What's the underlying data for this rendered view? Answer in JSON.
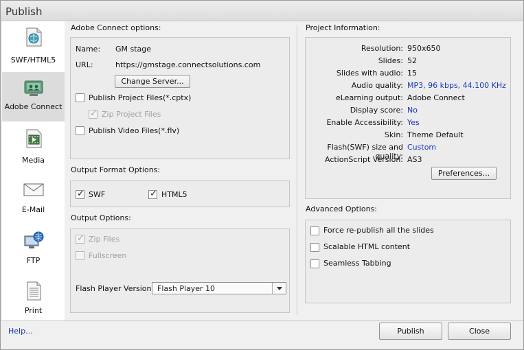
{
  "window": {
    "title": "Publish"
  },
  "sidebar": {
    "items": [
      {
        "label": "SWF/HTML5",
        "icon": "swf-html5-icon"
      },
      {
        "label": "Adobe Connect",
        "icon": "adobe-connect-icon",
        "active": true
      },
      {
        "label": "Media",
        "icon": "media-icon"
      },
      {
        "label": "E-Mail",
        "icon": "email-icon"
      },
      {
        "label": "FTP",
        "icon": "ftp-icon"
      },
      {
        "label": "Print",
        "icon": "print-icon"
      }
    ]
  },
  "connect": {
    "section_label": "Adobe Connect options:",
    "name_label": "Name:",
    "name_value": "GM stage",
    "url_label": "URL:",
    "url_value": "https://gmstage.connectsolutions.com",
    "change_server": "Change Server...",
    "publish_project_files": "Publish Project Files(*.cptx)",
    "zip_project_files": "Zip Project Files",
    "publish_video_files": "Publish Video Files(*.flv)"
  },
  "output_format": {
    "section_label": "Output Format Options:",
    "swf": "SWF",
    "html5": "HTML5"
  },
  "output_options": {
    "section_label": "Output Options:",
    "zip_files": "Zip Files",
    "fullscreen": "Fullscreen",
    "flash_version_label": "Flash Player Version:",
    "flash_version_value": "Flash Player 10"
  },
  "project_info": {
    "section_label": "Project Information:",
    "rows": [
      {
        "key": "Resolution:",
        "value": "950x650",
        "link": false
      },
      {
        "key": "Slides:",
        "value": "52",
        "link": false
      },
      {
        "key": "Slides with audio:",
        "value": "15",
        "link": false
      },
      {
        "key": "Audio quality:",
        "value": "MP3, 96 kbps, 44.100 KHz",
        "link": true
      },
      {
        "key": "eLearning output:",
        "value": "Adobe Connect",
        "link": false
      },
      {
        "key": "Display score:",
        "value": "No",
        "link": true
      },
      {
        "key": "Enable Accessibility:",
        "value": "Yes",
        "link": true
      },
      {
        "key": "Skin:",
        "value": "Theme Default",
        "link": false
      },
      {
        "key": "Flash(SWF) size and quality:",
        "value": "Custom",
        "link": true
      },
      {
        "key": "ActionScript Version:",
        "value": "AS3",
        "link": false
      }
    ],
    "preferences": "Preferences..."
  },
  "advanced": {
    "section_label": "Advanced Options:",
    "force_republish": "Force re-publish all the slides",
    "scalable_html": "Scalable HTML content",
    "seamless_tabbing": "Seamless Tabbing"
  },
  "footer": {
    "help": "Help...",
    "publish": "Publish",
    "close": "Close"
  }
}
